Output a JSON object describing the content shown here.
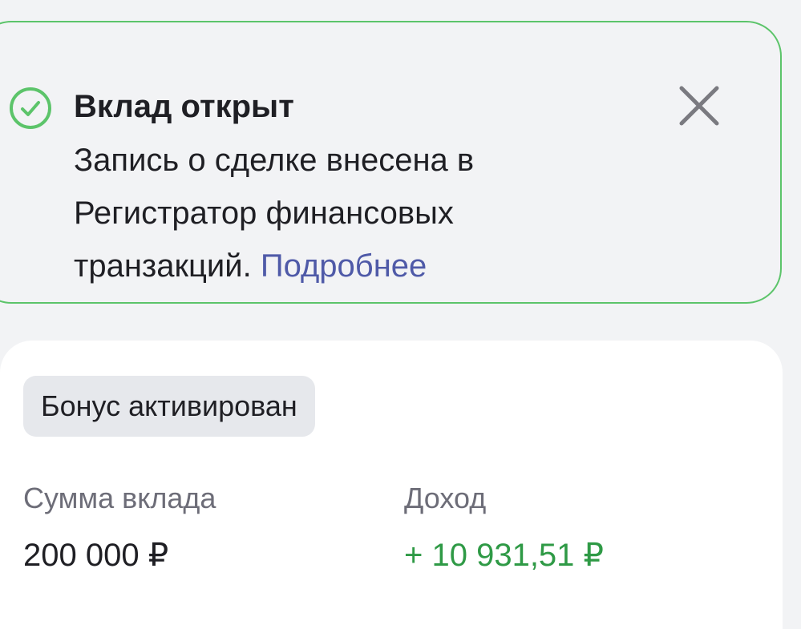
{
  "notice": {
    "title": "Вклад открыт",
    "text_line1": "Запись о сделке внесена в",
    "text_line2": "Регистратор финансовых",
    "text_line3": "транзакций.",
    "link": "Подробнее",
    "icons": {
      "status": "check-circle-icon",
      "close": "close-icon"
    },
    "colors": {
      "border": "#5cc46a",
      "link": "#4f5aa8"
    }
  },
  "deposit": {
    "badge": "Бонус активирован",
    "amount_label": "Сумма вклада",
    "amount_value": "200 000 ₽",
    "income_label": "Доход",
    "income_value": "+ 10 931,51 ₽",
    "income_color": "#2f9a46"
  }
}
